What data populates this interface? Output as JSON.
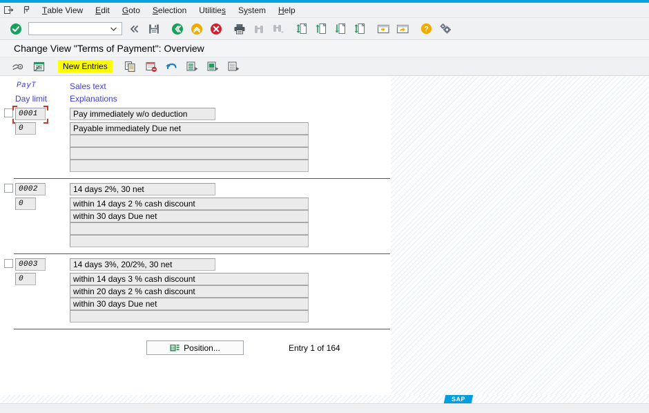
{
  "window": {
    "accent_color": "#0aa2dd",
    "title": "Change View \"Terms of Payment\": Overview"
  },
  "menubar": {
    "icons": [
      {
        "name": "exit-icon",
        "glyph": "exit"
      },
      {
        "name": "pin-icon",
        "glyph": "pin"
      }
    ],
    "items": [
      {
        "label": "Table View",
        "accel": "T"
      },
      {
        "label": "Edit",
        "accel": "E"
      },
      {
        "label": "Goto",
        "accel": "G"
      },
      {
        "label": "Selection",
        "accel": "S"
      },
      {
        "label": "Utilities",
        "accel": "s"
      },
      {
        "label": "System",
        "accel": "y"
      },
      {
        "label": "Help",
        "accel": "H"
      }
    ]
  },
  "toolbar": {
    "enter_tooltip": "Enter",
    "command_value": "",
    "command_placeholder": "",
    "buttons": [
      {
        "name": "back-arrows-icon",
        "label": "Back"
      },
      {
        "name": "save-icon",
        "label": "Save"
      },
      {
        "name": "back-green-icon",
        "label": "Back"
      },
      {
        "name": "exit-up-icon",
        "label": "Exit"
      },
      {
        "name": "cancel-icon",
        "label": "Cancel"
      },
      {
        "name": "print-icon",
        "label": "Print"
      },
      {
        "name": "find-icon",
        "label": "Find"
      },
      {
        "name": "find-next-icon",
        "label": "Find Next"
      },
      {
        "name": "first-page-icon",
        "label": "First Page"
      },
      {
        "name": "previous-page-icon",
        "label": "Previous Page"
      },
      {
        "name": "next-page-icon",
        "label": "Next Page"
      },
      {
        "name": "last-page-icon",
        "label": "Last Page"
      },
      {
        "name": "create-session-icon",
        "label": "Create New Session"
      },
      {
        "name": "create-shortcut-icon",
        "label": "Create Shortcut"
      },
      {
        "name": "help-icon",
        "label": "Help"
      },
      {
        "name": "customize-icon",
        "label": "Customizing of Local Layout"
      }
    ]
  },
  "apptoolbar": {
    "new_entries_label": "New Entries",
    "buttons": [
      {
        "name": "display-change-icon",
        "label": "Display/Change"
      },
      {
        "name": "check-table-icon",
        "label": "Check Table"
      },
      {
        "name": "copy-as-icon",
        "label": "Copy As..."
      },
      {
        "name": "delete-icon",
        "label": "Delete"
      },
      {
        "name": "undo-icon",
        "label": "Undo Change"
      },
      {
        "name": "select-all-icon",
        "label": "Select All"
      },
      {
        "name": "select-block-icon",
        "label": "Select Block"
      },
      {
        "name": "deselect-all-icon",
        "label": "Deselect All"
      }
    ]
  },
  "table": {
    "headers": {
      "payt": "PayT",
      "day_limit": "Day limit",
      "sales_text": "Sales text",
      "explanations": "Explanations"
    },
    "label_color": "#3c3cdc",
    "focus_color": "#c0392b",
    "highlight_color": "#ffff00",
    "rows": [
      {
        "key": "0001",
        "day_limit": "0",
        "selected": false,
        "focused": true,
        "sales_text": "Pay immediately w/o deduction",
        "explanations": [
          "Payable immediately Due net",
          "",
          "",
          ""
        ]
      },
      {
        "key": "0002",
        "day_limit": "0",
        "selected": false,
        "focused": false,
        "sales_text": "14 days 2%, 30 net",
        "explanations": [
          "within 14 days 2 % cash discount",
          "within 30 days Due net",
          "",
          ""
        ]
      },
      {
        "key": "0003",
        "day_limit": "0",
        "selected": false,
        "focused": false,
        "sales_text": "14 days 3%, 20/2%, 30 net",
        "explanations": [
          "within 14 days 3 % cash discount",
          "within 20 days 2 % cash discount",
          "within 30 days Due net",
          ""
        ]
      }
    ]
  },
  "footer": {
    "position_label": "Position...",
    "entry_counter": "Entry 1 of 164"
  },
  "branding": {
    "logo_text": "SAP"
  },
  "statusbar": {
    "message": ""
  }
}
